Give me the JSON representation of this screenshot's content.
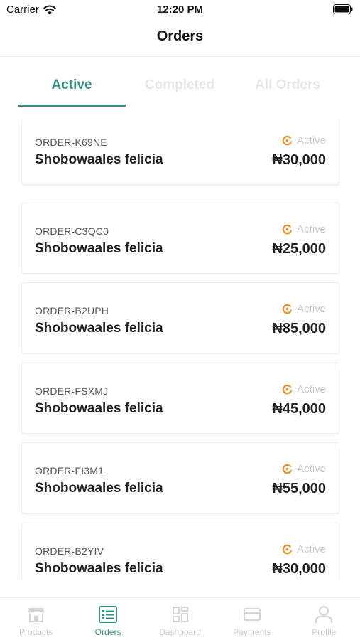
{
  "status_bar": {
    "carrier": "Carrier",
    "time": "12:20 PM"
  },
  "nav": {
    "title": "Orders"
  },
  "tabs": [
    {
      "label": "Active",
      "active": true
    },
    {
      "label": "Completed",
      "active": false
    },
    {
      "label": "All Orders",
      "active": false
    }
  ],
  "orders": [
    {
      "id": "ORDER-K69NE",
      "customer": "Shobowaales felicia",
      "status": "Active",
      "amount": "₦30,000"
    },
    {
      "id": "ORDER-C3QC0",
      "customer": "Shobowaales felicia",
      "status": "Active",
      "amount": "₦25,000"
    },
    {
      "id": "ORDER-B2UPH",
      "customer": "Shobowaales felicia",
      "status": "Active",
      "amount": "₦85,000"
    },
    {
      "id": "ORDER-FSXMJ",
      "customer": "Shobowaales felicia",
      "status": "Active",
      "amount": "₦45,000"
    },
    {
      "id": "ORDER-FI3M1",
      "customer": "Shobowaales felicia",
      "status": "Active",
      "amount": "₦55,000"
    },
    {
      "id": "ORDER-B2YIV",
      "customer": "Shobowaales felicia",
      "status": "Active",
      "amount": "₦30,000"
    }
  ],
  "tab_bar": [
    {
      "label": "Products",
      "icon": "store-icon",
      "active": false
    },
    {
      "label": "Orders",
      "icon": "list-icon",
      "active": true
    },
    {
      "label": "Dashboard",
      "icon": "grid-icon",
      "active": false
    },
    {
      "label": "Payments",
      "icon": "card-icon",
      "active": false
    },
    {
      "label": "Profile",
      "icon": "user-icon",
      "active": false
    }
  ],
  "colors": {
    "accent": "#3a8f86",
    "status_icon": "#e8902c",
    "inactive": "#c8c8c8"
  }
}
